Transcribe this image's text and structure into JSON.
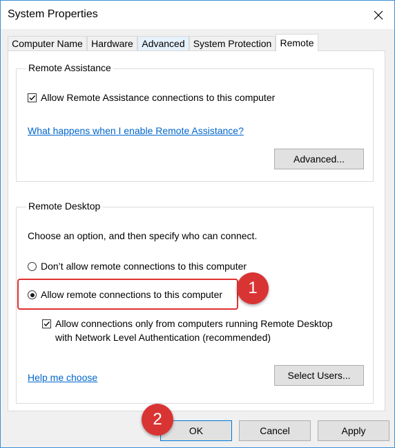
{
  "window": {
    "title": "System Properties",
    "close_icon": "close-icon"
  },
  "tabs": [
    {
      "label": "Computer Name",
      "active": false
    },
    {
      "label": "Hardware",
      "active": false
    },
    {
      "label": "Advanced",
      "active": false
    },
    {
      "label": "System Protection",
      "active": false
    },
    {
      "label": "Remote",
      "active": true
    }
  ],
  "remote_assistance": {
    "title": "Remote Assistance",
    "allow_label": "Allow Remote Assistance connections to this computer",
    "allow_checked": true,
    "help_link": "What happens when I enable Remote Assistance?",
    "advanced_button": "Advanced..."
  },
  "remote_desktop": {
    "title": "Remote Desktop",
    "instruction": "Choose an option, and then specify who can connect.",
    "option_disallow": "Don’t allow remote connections to this computer",
    "option_allow": "Allow remote connections to this computer",
    "selected_option": "allow",
    "nla_label_line1": "Allow connections only from computers running Remote Desktop",
    "nla_label_line2": "with Network Level Authentication (recommended)",
    "nla_checked": true,
    "help_link": "Help me choose",
    "select_users_button": "Select Users..."
  },
  "footer": {
    "ok": "OK",
    "cancel": "Cancel",
    "apply": "Apply"
  },
  "annotations": {
    "badge1": "1",
    "badge2": "2"
  },
  "colors": {
    "accent": "#0078d7",
    "link": "#0066cc",
    "annotation": "#d93434"
  }
}
